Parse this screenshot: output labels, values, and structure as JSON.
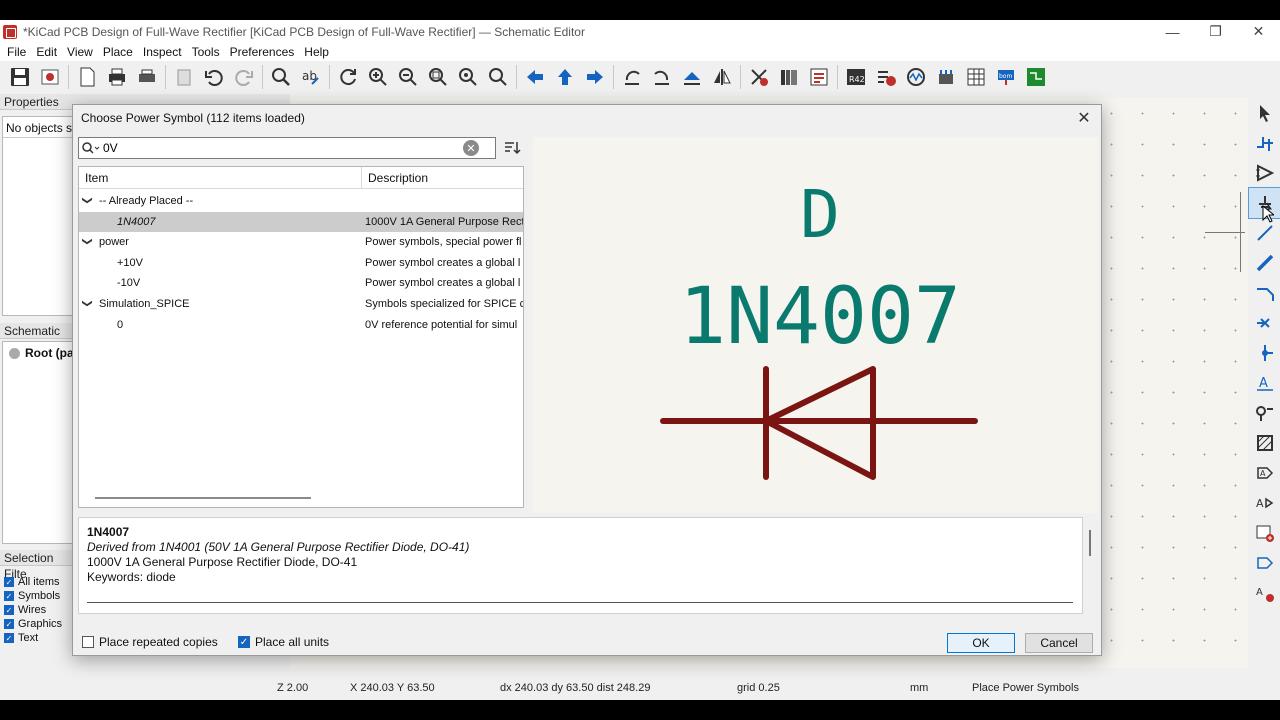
{
  "window": {
    "title": "*KiCad PCB Design of  Full-Wave Rectifier [KiCad PCB Design of  Full-Wave Rectifier] — Schematic Editor",
    "minimize": "—",
    "maximize": "❐",
    "close": "✕"
  },
  "menu": [
    "File",
    "Edit",
    "View",
    "Place",
    "Inspect",
    "Tools",
    "Preferences",
    "Help"
  ],
  "left_panels": {
    "properties_title": "Properties",
    "properties_empty": "No objects se",
    "hierarchy_title": "Schematic Hi",
    "hierarchy_root": "Root (pa",
    "selection_filter_title": "Selection Filte",
    "filters": [
      "All items",
      "Symbols",
      "Wires",
      "Graphics",
      "Text"
    ]
  },
  "dialog": {
    "title": "Choose Power Symbol (112 items loaded)",
    "close": "✕",
    "search_value": "0V",
    "columns": {
      "item": "Item",
      "description": "Description"
    },
    "rows": [
      {
        "indent": 0,
        "expander": "❯",
        "item": "-- Already Placed --",
        "desc": "",
        "selected": false,
        "italic": false
      },
      {
        "indent": 2,
        "expander": "",
        "item": "1N4007",
        "desc": "1000V 1A General Purpose Recti",
        "selected": true,
        "italic": true
      },
      {
        "indent": 0,
        "expander": "❯",
        "item": "power",
        "desc": "Power symbols, special power fl",
        "selected": false,
        "italic": false
      },
      {
        "indent": 2,
        "expander": "",
        "item": "+10V",
        "desc": "Power symbol creates a global l",
        "selected": false,
        "italic": false
      },
      {
        "indent": 2,
        "expander": "",
        "item": "-10V",
        "desc": "Power symbol creates a global l",
        "selected": false,
        "italic": false
      },
      {
        "indent": 0,
        "expander": "❯",
        "item": "Simulation_SPICE",
        "desc": "Symbols specialized for SPICE ci",
        "selected": false,
        "italic": false
      },
      {
        "indent": 2,
        "expander": "",
        "item": "0",
        "desc": "0V reference potential for simul",
        "selected": false,
        "italic": false
      }
    ],
    "preview": {
      "ref": "D",
      "value": "1N4007",
      "body_color": "#7a1512",
      "text_color": "#0b7a6e"
    },
    "details": {
      "name": "1N4007",
      "derived": "Derived from 1N4001 (50V 1A General Purpose Rectifier Diode, DO-41)",
      "description": "1000V 1A General Purpose Rectifier Diode, DO-41",
      "keywords": "Keywords: diode"
    },
    "place_repeated": {
      "label": "Place repeated copies",
      "checked": false
    },
    "place_all_units": {
      "label": "Place all units",
      "checked": true
    },
    "ok_label": "OK",
    "cancel_label": "Cancel"
  },
  "status": {
    "zoom": "Z 2.00",
    "cursor": "X 240.03  Y 63.50",
    "delta": "dx 240.03  dy 63.50  dist 248.29",
    "grid": "grid 0.25",
    "units": "mm",
    "mode": "Place Power Symbols"
  }
}
